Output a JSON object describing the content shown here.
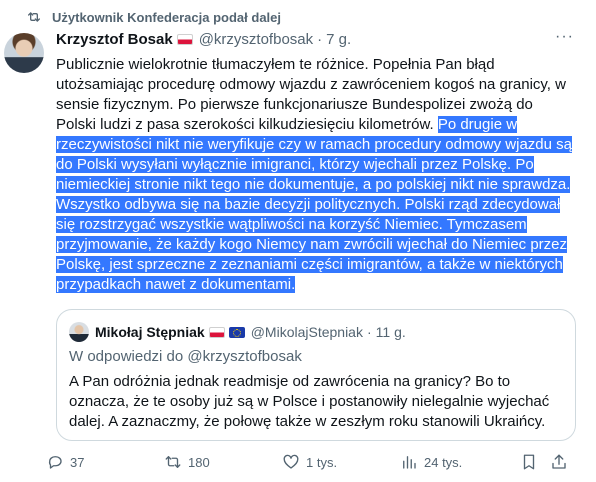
{
  "repost": {
    "icon": "repost-icon",
    "text": "Użytkownik Konfederacja podał dalej"
  },
  "tweet": {
    "author_name": "Krzysztof Bosak",
    "handle": "@krzysztofbosak",
    "separator": "·",
    "time": "7 g.",
    "more_label": "···",
    "text_plain": "Publicznie wielokrotnie tłumaczyłem te różnice. Popełnia Pan błąd utożsamiając procedurę odmowy wjazdu z zawróceniem kogoś na granicy, w sensie fizycznym. Po pierwsze funkcjonariusze Bundespolizei zwożą do Polski ludzi z pasa szerokości kilkudziesięciu kilometrów.",
    "text_highlighted": "Po drugie w rzeczywistości nikt nie weryfikuje czy w ramach procedury odmowy wjazdu są do Polski wysyłani wyłącznie imigranci, którzy wjechali przez Polskę. Po niemieckiej stronie nikt tego nie dokumentuje, a po polskiej nikt nie sprawdza. Wszystko odbywa się na bazie decyzji politycznych. Polski rząd zdecydował się rozstrzygać wszystkie wątpliwości na korzyść Niemiec. Tymczasem przyjmowanie, że każdy kogo Niemcy nam zwrócili wjechał do Niemiec przez Polskę, jest sprzeczne z zeznaniami części imigrantów, a także w niektórych przypadkach nawet z dokumentami."
  },
  "quote": {
    "author_name": "Mikołaj Stępniak",
    "handle": "@MikolajStepniak",
    "separator": "·",
    "time": "11 g.",
    "reply_to": "W odpowiedzi do @krzysztofbosak",
    "text": "A Pan odróżnia jednak readmisje od zawrócenia na granicy? Bo to oznacza, że te osoby już są w Polsce i postanowiły nielegalnie wyjechać dalej. A zaznaczmy, że połowę także w zeszłym roku stanowili Ukraińcy."
  },
  "actions": {
    "reply_count": "37",
    "repost_count": "180",
    "like_count": "1 tys.",
    "views_count": "24 tys."
  },
  "colors": {
    "text": "#0f1419",
    "muted": "#536471",
    "highlight": "#3478ff",
    "border": "#cfd9de"
  }
}
